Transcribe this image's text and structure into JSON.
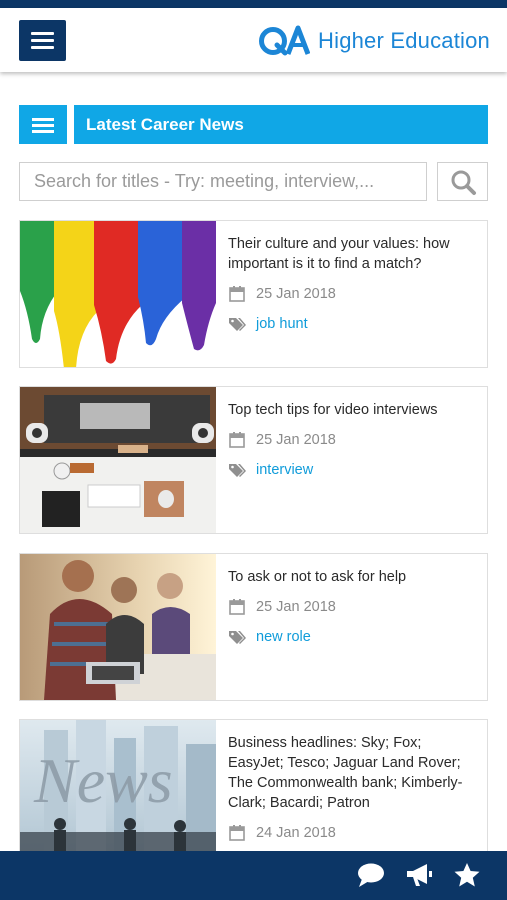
{
  "header": {
    "logo_text": "QA",
    "brand_text": "Higher Education"
  },
  "section": {
    "title": "Latest Career News"
  },
  "search": {
    "placeholder": "Search for titles - Try: meeting, interview,..."
  },
  "articles": [
    {
      "title": "Their culture and your values: how important is it to find a match?",
      "date": "25 Jan 2018",
      "tag": "job hunt"
    },
    {
      "title": "Top tech tips for video interviews",
      "date": "25 Jan 2018",
      "tag": "interview"
    },
    {
      "title": "To ask or not to ask for help",
      "date": "25 Jan 2018",
      "tag": "new role"
    },
    {
      "title": "Business headlines: Sky; Fox; EasyJet; Tesco; Jaguar Land Rover; The Commonwealth bank; Kimberly-Clark; Bacardi; Patron",
      "date": "24 Jan 2018",
      "tag": ""
    }
  ],
  "thumb_text": {
    "news": "News"
  },
  "colors": {
    "navy": "#0c3666",
    "accent": "#10a7e6",
    "tag": "#109cda",
    "brand": "#1c86d6"
  },
  "icons": {
    "menu": "hamburger-icon",
    "section_menu": "hamburger-icon",
    "search": "search-icon",
    "date": "calendar-icon",
    "tag": "tag-icon",
    "chat": "chat-icon",
    "announce": "megaphone-icon",
    "favorites": "star-icon"
  }
}
